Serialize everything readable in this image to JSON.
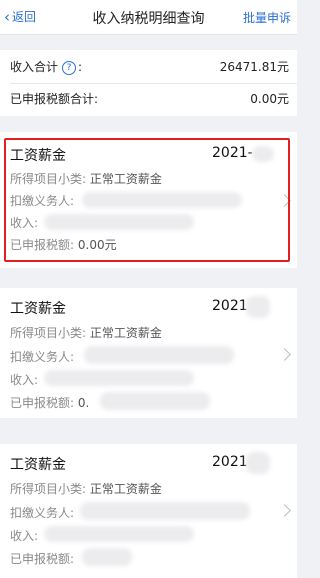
{
  "nav": {
    "back_label": "返回",
    "title": "收入纳税明细查询",
    "batch_label": "批量申诉"
  },
  "summary": {
    "income_total_label": "收入合计",
    "income_total_value": "26471.81元",
    "declared_tax_label": "已申报税额合计:",
    "declared_tax_value": "0.00元"
  },
  "records": [
    {
      "type": "工资薪金",
      "date": "2021-",
      "subcategory_label": "所得项目小类:",
      "subcategory_value": "正常工资薪金",
      "withholder_label": "扣缴义务人:",
      "income_label": "收入:",
      "declared_tax_label": "已申报税额:",
      "declared_tax_value": "0.00元"
    },
    {
      "type": "工资薪金",
      "date": "2021",
      "subcategory_label": "所得项目小类:",
      "subcategory_value": "正常工资薪金",
      "withholder_label": "扣缴义务人:",
      "income_label": "收入:",
      "declared_tax_label": "已申报税额:",
      "declared_tax_value": "0."
    },
    {
      "type": "工资薪金",
      "date": "2021",
      "subcategory_label": "所得项目小类:",
      "subcategory_value": "正常工资薪金",
      "withholder_label": "扣缴义务人:",
      "income_label": "收入:",
      "declared_tax_label": "已申报税额:",
      "declared_tax_value": ""
    }
  ],
  "icons": {
    "back": "chevron-left-icon",
    "help": "question-circle-icon",
    "row_arrow": "chevron-right-icon"
  },
  "colors": {
    "accent": "#2b6fd6",
    "highlight": "#e02020",
    "background": "#f0f1f5"
  }
}
